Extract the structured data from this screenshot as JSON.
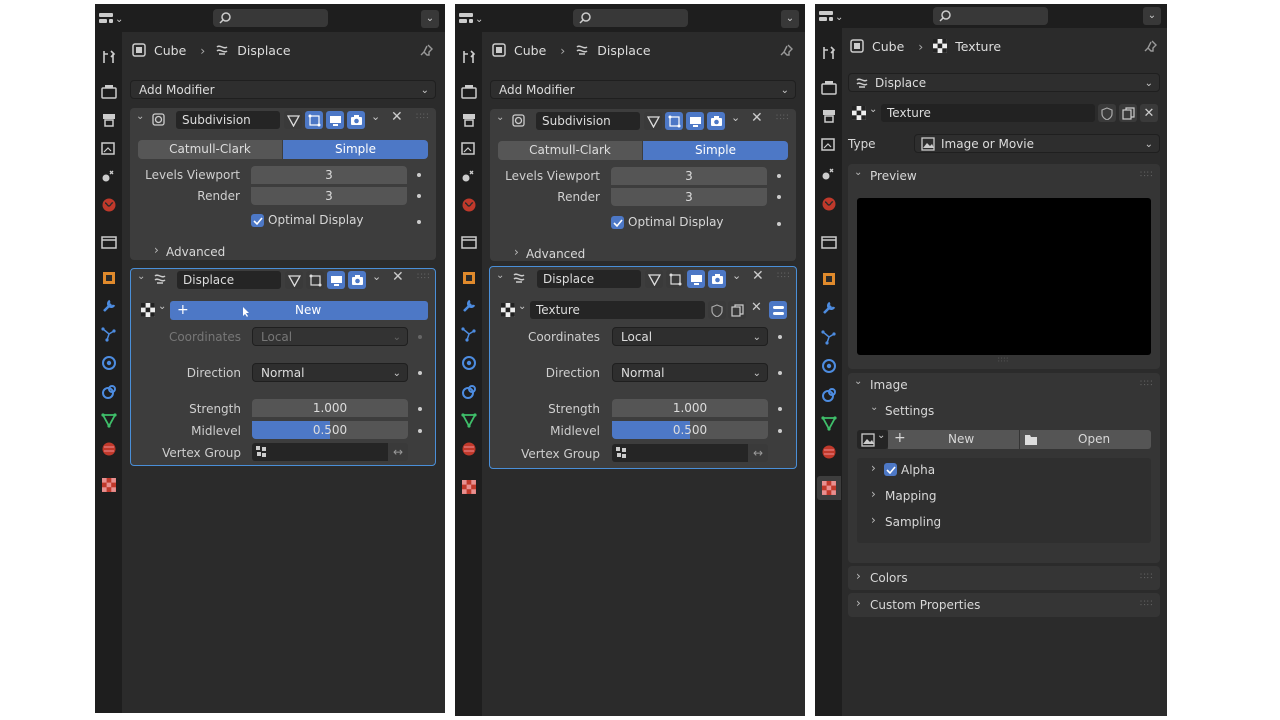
{
  "panel1": {
    "breadcrumb": {
      "object": "Cube",
      "modifier": "Displace"
    },
    "add_modifier": "Add Modifier",
    "subdivision": {
      "name": "Subdivision",
      "seg_a": "Catmull-Clark",
      "seg_b": "Simple",
      "levels_viewport_label": "Levels Viewport",
      "levels_viewport": "3",
      "render_label": "Render",
      "render": "3",
      "optimal_display": "Optimal Display",
      "advanced": "Advanced"
    },
    "displace": {
      "name": "Displace",
      "new_label": "New",
      "coordinates_label": "Coordinates",
      "coordinates": "Local",
      "direction_label": "Direction",
      "direction": "Normal",
      "strength_label": "Strength",
      "strength": "1.000",
      "midlevel_label": "Midlevel",
      "midlevel": "0.500",
      "vertex_group_label": "Vertex Group"
    }
  },
  "panel2": {
    "breadcrumb": {
      "object": "Cube",
      "modifier": "Displace"
    },
    "add_modifier": "Add Modifier",
    "subdivision": {
      "name": "Subdivision",
      "seg_a": "Catmull-Clark",
      "seg_b": "Simple",
      "levels_viewport_label": "Levels Viewport",
      "levels_viewport": "3",
      "render_label": "Render",
      "render": "3",
      "optimal_display": "Optimal Display",
      "advanced": "Advanced"
    },
    "displace": {
      "name": "Displace",
      "texture_name": "Texture",
      "coordinates_label": "Coordinates",
      "coordinates": "Local",
      "direction_label": "Direction",
      "direction": "Normal",
      "strength_label": "Strength",
      "strength": "1.000",
      "midlevel_label": "Midlevel",
      "midlevel": "0.500",
      "vertex_group_label": "Vertex Group"
    }
  },
  "panel3": {
    "breadcrumb": {
      "object": "Cube",
      "texture": "Texture"
    },
    "modifier_select": "Displace",
    "texture_name": "Texture",
    "type_label": "Type",
    "type_value": "Image or Movie",
    "preview": "Preview",
    "image": "Image",
    "settings": "Settings",
    "new_label": "New",
    "open_label": "Open",
    "alpha": "Alpha",
    "mapping": "Mapping",
    "sampling": "Sampling",
    "colors": "Colors",
    "custom_properties": "Custom Properties"
  },
  "colors": {
    "accent": "#4d78c6",
    "panel_bg": "#2b2b2b",
    "header_bg": "#1e1e1e",
    "active_outline": "#4a8fd8"
  },
  "midlevel_fraction": 0.5
}
